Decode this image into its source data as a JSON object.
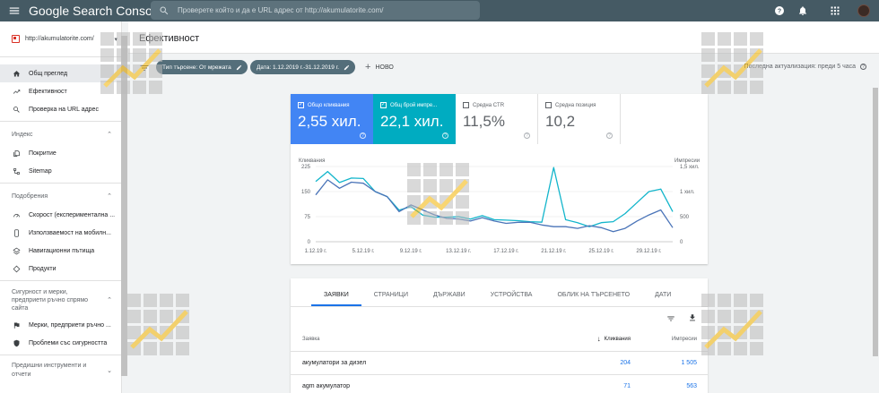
{
  "topbar": {
    "logo": "Google Search Console",
    "search_placeholder": "Проверете който и да е URL адрес от http://akumulatorite.com/"
  },
  "sidebar": {
    "property": "http://akumulatorite.com/",
    "items_top": [
      {
        "label": "Общ преглед",
        "icon": "home-icon",
        "active": true
      },
      {
        "label": "Ефективност",
        "icon": "trending-icon",
        "active": false
      },
      {
        "label": "Проверка на URL адрес",
        "icon": "search-icon",
        "active": false
      }
    ],
    "section_index": {
      "title": "Индекс",
      "items": [
        {
          "label": "Покритие",
          "icon": "file-copy-icon"
        },
        {
          "label": "Sitemap",
          "icon": "sitemap-icon"
        }
      ]
    },
    "section_enh": {
      "title": "Подобрения",
      "items": [
        {
          "label": "Скорост (експериментална ...",
          "icon": "speed-icon"
        },
        {
          "label": "Използваемост на мобилн...",
          "icon": "phone-icon"
        },
        {
          "label": "Навигационни пътища",
          "icon": "layers-icon"
        },
        {
          "label": "Продукти",
          "icon": "diamond-icon"
        }
      ]
    },
    "section_security": {
      "title_line1": "Сигурност и мерки,",
      "title_line2": "предприети ръчно спрямо",
      "title_line3": "сайта",
      "items": [
        {
          "label": "Мерки, предприети ръчно ...",
          "icon": "flag-icon"
        },
        {
          "label": "Проблеми със сигурността",
          "icon": "shield-icon"
        }
      ]
    },
    "section_legacy": {
      "title_line1": "Предишни инструменти и",
      "title_line2": "отчети"
    }
  },
  "header": {
    "title": "Ефективност"
  },
  "filters": {
    "chip1": "Тип търсене: От мрежата",
    "chip2": "Дата: 1.12.2019 г.-31.12.2019 г.",
    "new_label": "НОВО",
    "last_update": "Последна актуализация: преди 5 часа"
  },
  "metrics": [
    {
      "label": "Общо кликвания",
      "value": "2,55 хил.",
      "checked": true,
      "color": "#4285f4"
    },
    {
      "label": "Общ брой импре...",
      "value": "22,1 хил.",
      "checked": true,
      "color": "#00acc1"
    },
    {
      "label": "Средна CTR",
      "value": "11,5%",
      "checked": false
    },
    {
      "label": "Средна позиция",
      "value": "10,2",
      "checked": false
    }
  ],
  "chart_data": {
    "type": "line",
    "ylabel_left": "Кликвания",
    "ylabel_right": "Импресии",
    "left_ticks": [
      "225",
      "150",
      "75",
      "0"
    ],
    "right_ticks": [
      "1,5 хил.",
      "1 хил.",
      "500",
      "0"
    ],
    "ylim_left": [
      0,
      225
    ],
    "ylim_right": [
      0,
      1500
    ],
    "categories": [
      "1.12.19 г.",
      "5.12.19 г.",
      "9.12.19 г.",
      "13.12.19 г.",
      "17.12.19 г.",
      "21.12.19 г.",
      "25.12.19 г.",
      "29.12.19 г."
    ],
    "x": [
      1,
      2,
      3,
      4,
      5,
      6,
      7,
      8,
      9,
      10,
      11,
      12,
      13,
      14,
      15,
      16,
      17,
      18,
      19,
      20,
      21,
      22,
      23,
      24,
      25,
      26,
      27,
      28,
      29,
      30,
      31
    ],
    "series": [
      {
        "name": "Кликвания",
        "axis": "left",
        "color": "#4a74b8",
        "values": [
          140,
          185,
          160,
          178,
          175,
          150,
          135,
          90,
          110,
          95,
          80,
          70,
          68,
          62,
          72,
          62,
          55,
          58,
          58,
          50,
          45,
          45,
          40,
          48,
          42,
          30,
          40,
          62,
          80,
          95,
          42
        ]
      },
      {
        "name": "Импресии",
        "axis": "right",
        "color": "#12b5cb",
        "values": [
          1200,
          1400,
          1180,
          1270,
          1260,
          1000,
          900,
          630,
          700,
          530,
          490,
          490,
          500,
          450,
          520,
          440,
          430,
          420,
          400,
          390,
          1480,
          440,
          380,
          300,
          380,
          400,
          560,
          780,
          1000,
          1050,
          600
        ]
      }
    ]
  },
  "table": {
    "tabs": [
      "ЗАЯВКИ",
      "СТРАНИЦИ",
      "ДЪРЖАВИ",
      "УСТРОЙСТВА",
      "ОБЛИК НА ТЪРСЕНЕТО",
      "ДАТИ"
    ],
    "col_query": "Заявка",
    "col_clicks": "Кликвания",
    "col_impressions": "Импресии",
    "rows": [
      {
        "query": "акумулатори за дизел",
        "clicks": "204",
        "impressions": "1 505"
      },
      {
        "query": "agm акумулатор",
        "clicks": "71",
        "impressions": "563"
      }
    ]
  }
}
